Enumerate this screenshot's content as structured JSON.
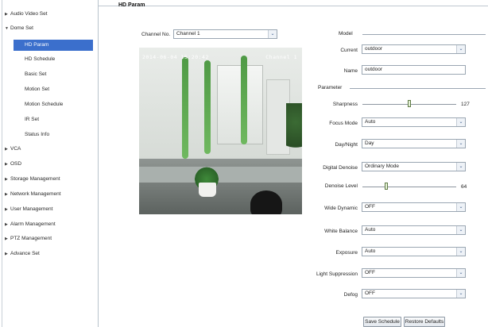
{
  "sidebar": {
    "items": [
      {
        "label": "Audio Video Set",
        "expanded": false
      },
      {
        "label": "Dome Set",
        "expanded": true
      },
      {
        "label": "VCA",
        "expanded": false
      },
      {
        "label": "OSD",
        "expanded": false
      },
      {
        "label": "Storage Management",
        "expanded": false
      },
      {
        "label": "Network Management",
        "expanded": false
      },
      {
        "label": "User Management",
        "expanded": false
      },
      {
        "label": "Alarm Management",
        "expanded": false
      },
      {
        "label": "PTZ Management",
        "expanded": false
      },
      {
        "label": "Advance Set",
        "expanded": false
      }
    ],
    "subitems": [
      {
        "label": "HD Param",
        "active": true
      },
      {
        "label": "HD Schedule",
        "active": false
      },
      {
        "label": "Basic Set",
        "active": false
      },
      {
        "label": "Motion Set",
        "active": false
      },
      {
        "label": "Motion Schedule",
        "active": false
      },
      {
        "label": "IR Set",
        "active": false
      },
      {
        "label": "Status Info",
        "active": false
      }
    ]
  },
  "page": {
    "title": "HD Param"
  },
  "channel": {
    "label": "Channel No.",
    "value": "Channel 1"
  },
  "video": {
    "osd_time": "2014-06-04 15:20:42",
    "osd_channel": "Channel 1"
  },
  "model": {
    "section_label": "Model",
    "current_label": "Current",
    "current_value": "outdoor",
    "name_label": "Name",
    "name_value": "outdoor"
  },
  "parameter": {
    "section_label": "Parameter",
    "sharpness": {
      "label": "Sharpness",
      "value": 127,
      "max": 255
    },
    "focus_mode": {
      "label": "Focus Mode",
      "value": "Auto"
    },
    "day_night": {
      "label": "Day/Night",
      "value": "Day"
    },
    "digital_denoise": {
      "label": "Digital Denoise",
      "value": "Ordinary Mode"
    },
    "denoise_level": {
      "label": "Denoise Level",
      "value": 64,
      "max": 255
    },
    "wide_dynamic": {
      "label": "Wide Dynamic",
      "value": "OFF"
    },
    "white_balance": {
      "label": "White Balance",
      "value": "Auto"
    },
    "exposure": {
      "label": "Exposure",
      "value": "Auto"
    },
    "light_suppression": {
      "label": "Light Suppression",
      "value": "OFF"
    },
    "defog": {
      "label": "Defog",
      "value": "OFF"
    }
  },
  "buttons": {
    "save": "Save Schedule",
    "restore": "Restore Defaults"
  },
  "icons": {
    "dropdown": "chevron-down-icon",
    "collapsed": "triangle-right-icon",
    "expanded": "triangle-down-icon"
  },
  "colors": {
    "active_bg": "#3b6fcc",
    "border": "#9aa6b2"
  }
}
